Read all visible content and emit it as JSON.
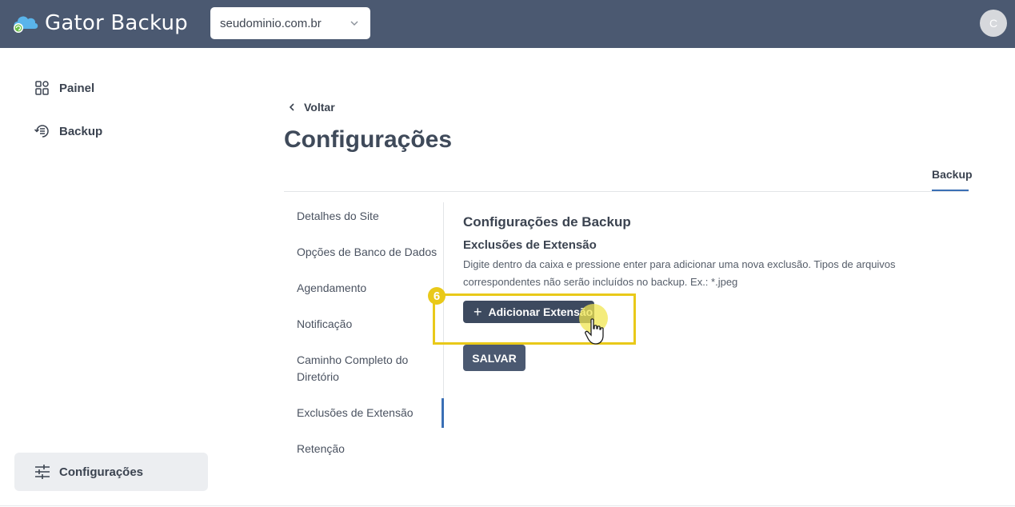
{
  "header": {
    "app_title": "Gator Backup",
    "domain_select": {
      "value": "seudominio.com.br"
    },
    "avatar_initial": "C"
  },
  "sidebar": {
    "items": [
      {
        "label": "Painel",
        "icon": "dashboard-icon"
      },
      {
        "label": "Backup",
        "icon": "backup-restore-icon"
      }
    ],
    "bottom_item": {
      "label": "Configurações",
      "icon": "sliders-icon"
    }
  },
  "main": {
    "back_label": "Voltar",
    "title": "Configurações",
    "tabs": [
      {
        "label": "Backup",
        "active": true
      }
    ],
    "sub_nav": [
      "Detalhes do Site",
      "Opções de Banco de Dados",
      "Agendamento",
      "Notificação",
      "Caminho Completo do Diretório",
      "Exclusões de Extensão",
      "Retenção"
    ],
    "sub_nav_active": "Exclusões de Extensão",
    "section": {
      "title": "Configurações de Backup",
      "subtitle": "Exclusões de Extensão",
      "description": "Digite dentro da caixa e pressione enter para adicionar uma nova exclusão. Tipos de arquivos correspondentes não serão incluídos no backup. Ex.: *.jpeg",
      "add_button": "Adicionar Extensão",
      "save_button": "SALVAR"
    }
  },
  "annotation": {
    "step_number": "6",
    "color": "#e9c919"
  },
  "colors": {
    "topbar": "#4b5971",
    "accent": "#3a6fb5",
    "button_dark": "#3d4a5f"
  }
}
